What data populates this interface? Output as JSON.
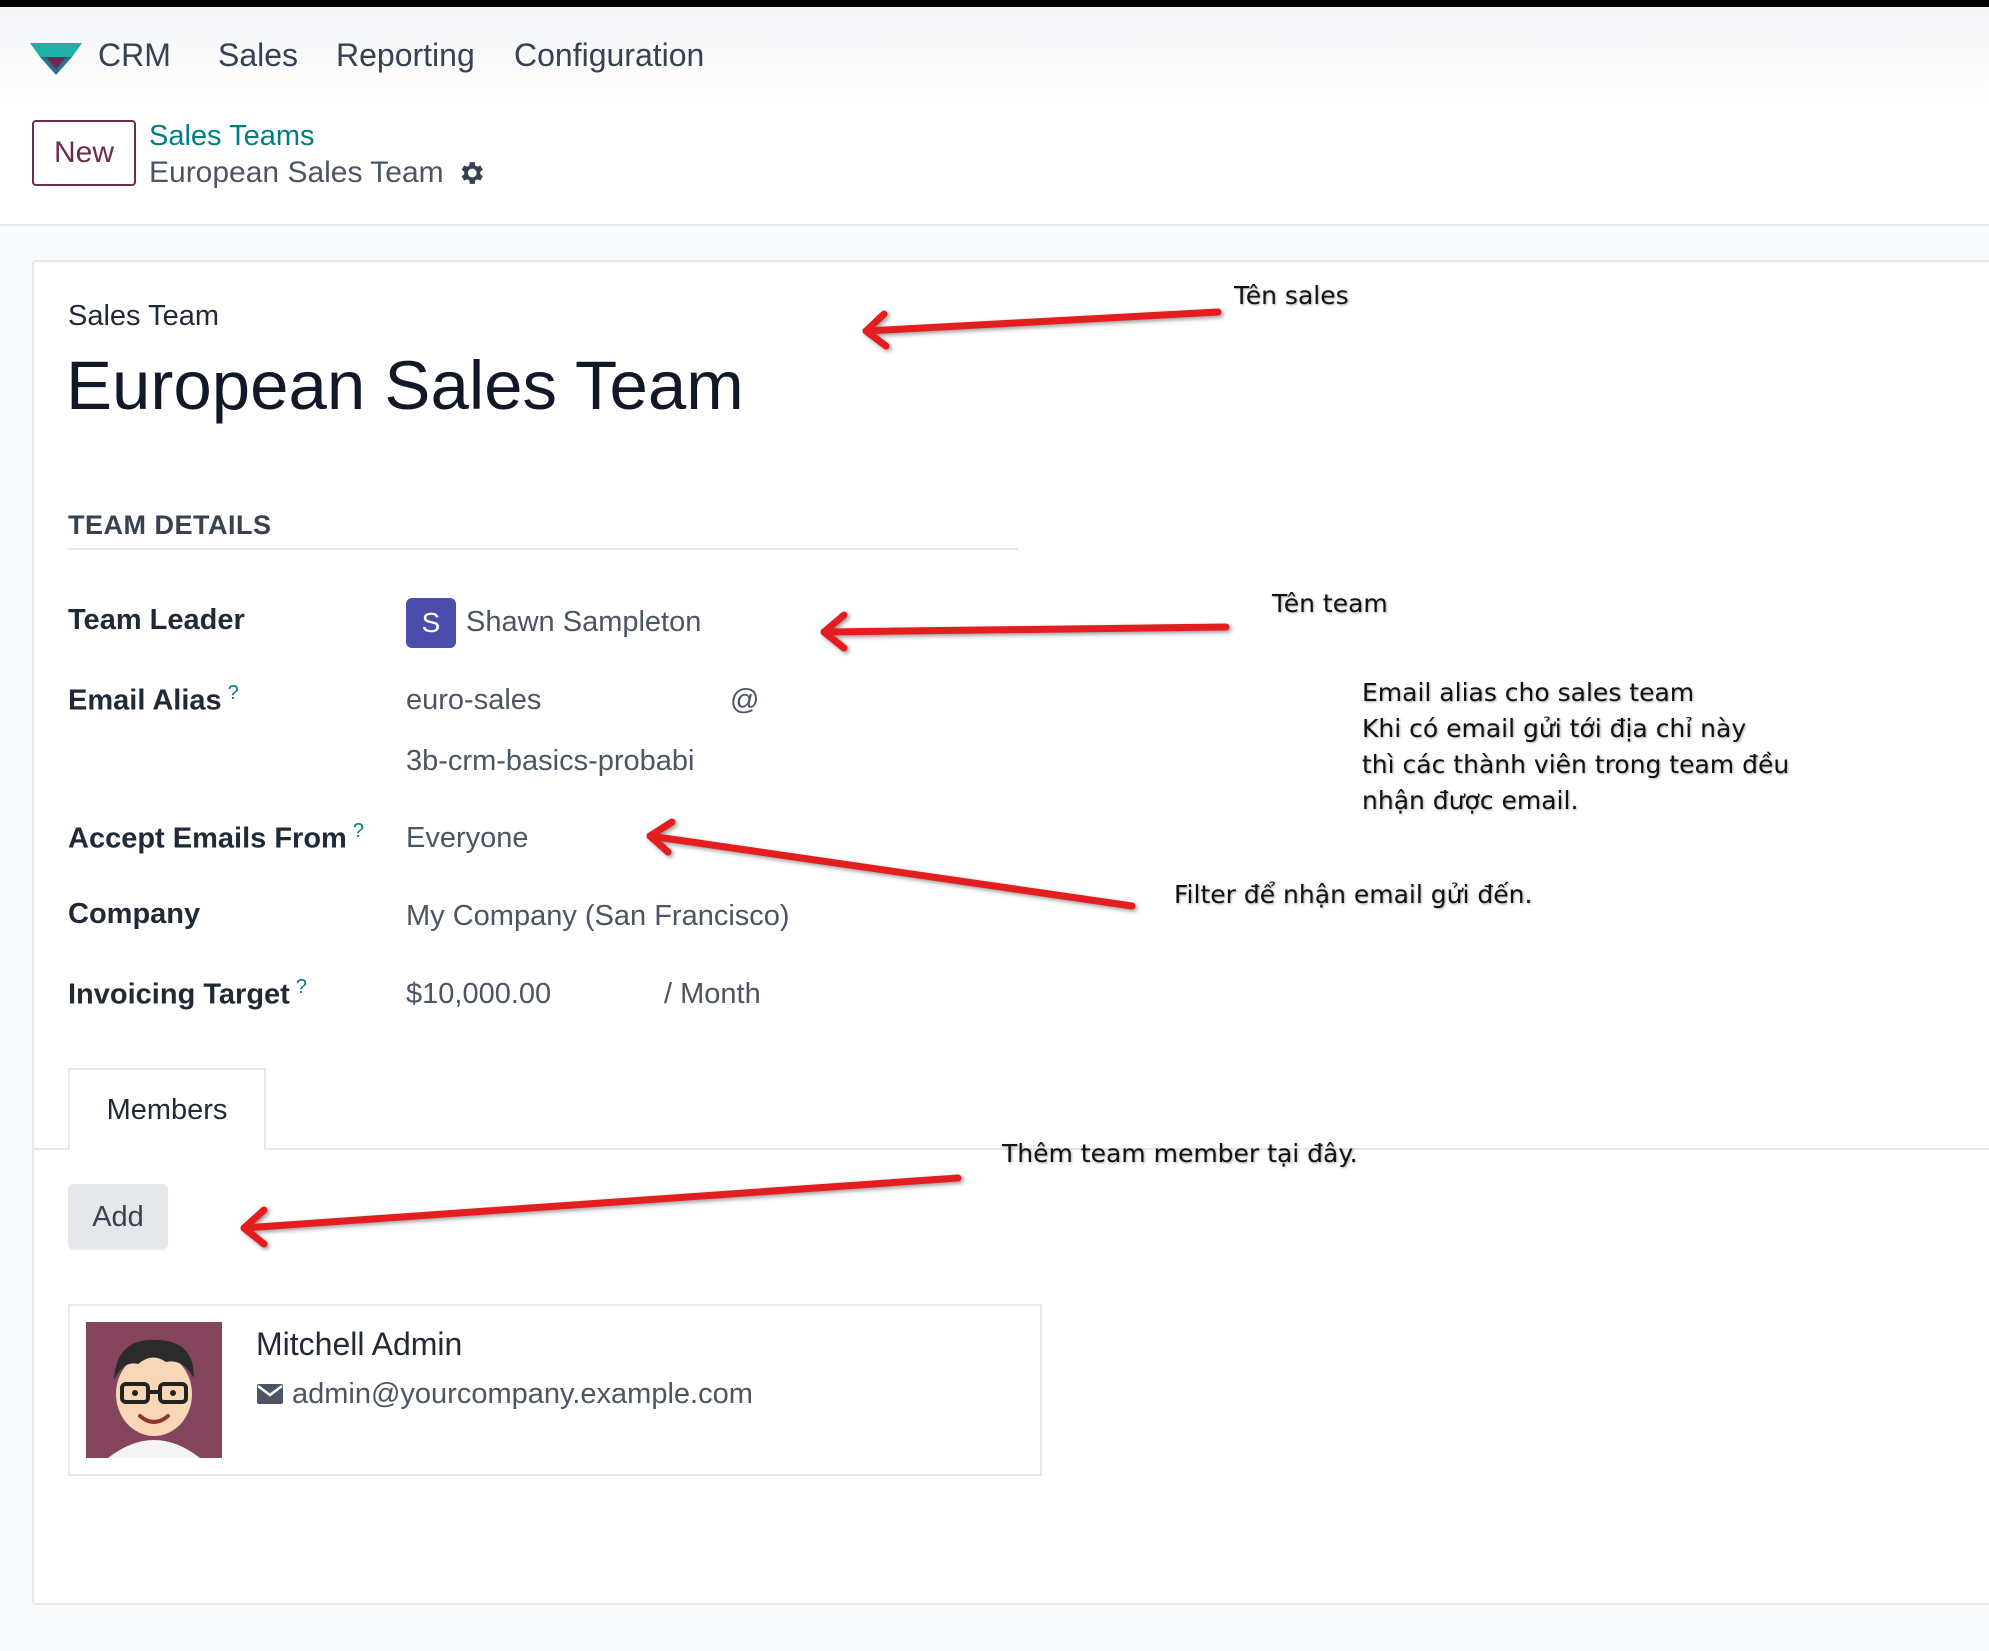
{
  "navbar": {
    "app_name": "CRM",
    "menu": [
      "Sales",
      "Reporting",
      "Configuration"
    ]
  },
  "control_panel": {
    "new_button": "New",
    "breadcrumb_parent": "Sales Teams",
    "breadcrumb_current": "European Sales Team"
  },
  "form": {
    "label": "Sales Team",
    "title": "European Sales Team",
    "section_title": "TEAM DETAILS",
    "fields": {
      "team_leader_label": "Team Leader",
      "team_leader_initial": "S",
      "team_leader_value": "Shawn Sampleton",
      "email_alias_label": "Email Alias",
      "email_alias_help": "?",
      "email_alias_value": "euro-sales",
      "email_alias_at": "@",
      "email_alias_domain": "3b-crm-basics-probabi",
      "accept_emails_label": "Accept Emails From",
      "accept_emails_help": "?",
      "accept_emails_value": "Everyone",
      "company_label": "Company",
      "company_value": "My Company (San Francisco)",
      "invoicing_label": "Invoicing Target",
      "invoicing_help": "?",
      "invoicing_value": "$10,000.00",
      "invoicing_period": "/ Month"
    },
    "tabs": [
      "Members"
    ],
    "add_button": "Add",
    "members": [
      {
        "name": "Mitchell Admin",
        "email": "admin@yourcompany.example.com"
      }
    ]
  },
  "annotations": {
    "ten_sales": "Tên sales",
    "ten_team": "Tên team",
    "email_alias_lines": [
      "Email alias cho sales team",
      "Khi có email gửi tới địa chỉ này",
      "thì các thành viên trong team đều",
      "nhận được email."
    ],
    "filter": "Filter để nhận email gửi đến.",
    "them_member": "Thêm team member tại đây."
  },
  "colors": {
    "brand_primary": "#6b2c4f",
    "link_teal": "#017e84",
    "avatar_indigo": "#4c4cad",
    "annotation_arrow": "#e41e1e"
  }
}
